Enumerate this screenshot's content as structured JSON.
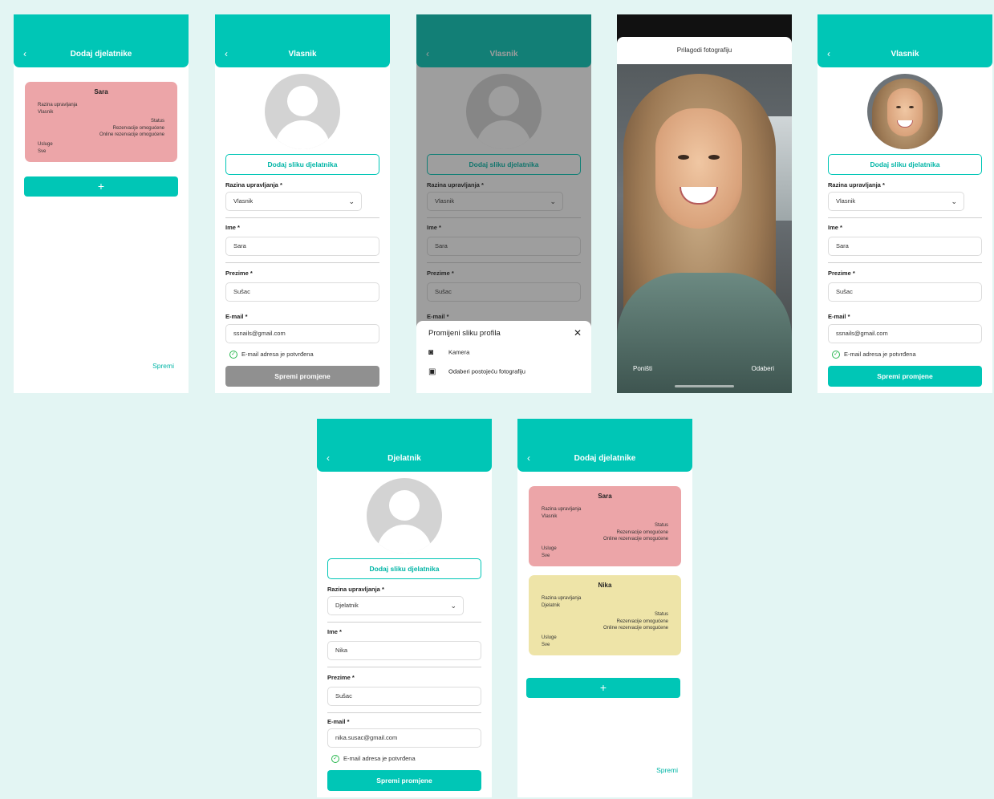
{
  "colors": {
    "teal": "#00c6b6",
    "background": "#e3f5f3",
    "card_red": "#eca5a8",
    "card_yellow": "#eee4a8",
    "disabled_button": "#909090",
    "check_green": "#2ab850"
  },
  "icons": {
    "back": "chevron-left-icon",
    "dropdown": "chevron-down-icon",
    "verified": "check-circle-icon",
    "close": "close-icon",
    "camera": "camera-icon",
    "gallery": "gallery-icon",
    "add": "plus-icon",
    "avatar": "person-placeholder-icon"
  },
  "labels": {
    "add_photo": "Dodaj sliku djelatnika",
    "role_label": "Razina upravljanja *",
    "name_label": "Ime *",
    "surname_label": "Prezime *",
    "email_label": "E-mail *",
    "email_verified": "E-mail adresa je potvrđena",
    "save_changes": "Spremi promjene",
    "save": "Spremi",
    "add": "+"
  },
  "card_labels": {
    "role": "Razina upravljanja",
    "status": "Status",
    "booking": "Rezervacije omogućene",
    "online_booking": "Online rezervacije omogućene",
    "services": "Usluge",
    "services_value": "Sve"
  },
  "employees": [
    {
      "name": "Sara",
      "role": "Vlasnik"
    },
    {
      "name": "Nika",
      "role": "Djelatnik"
    }
  ],
  "screens": {
    "add_employees": {
      "title": "Dodaj djelatnike"
    },
    "owner": {
      "title": "Vlasnik",
      "role": "Vlasnik",
      "first_name": "Sara",
      "last_name": "Sušac",
      "email": "ssnails@gmail.com"
    },
    "worker": {
      "title": "Djelatnik",
      "role": "Djelatnik",
      "first_name": "Nika",
      "last_name": "Sušac",
      "email": "nika.susac@gmail.com"
    },
    "sheet": {
      "title": "Promijeni sliku profila",
      "camera": "Kamera",
      "gallery": "Odaberi postojeću fotografiju"
    },
    "crop": {
      "title": "Prilagodi fotografiju",
      "cancel": "Poništi",
      "select": "Odaberi"
    }
  }
}
